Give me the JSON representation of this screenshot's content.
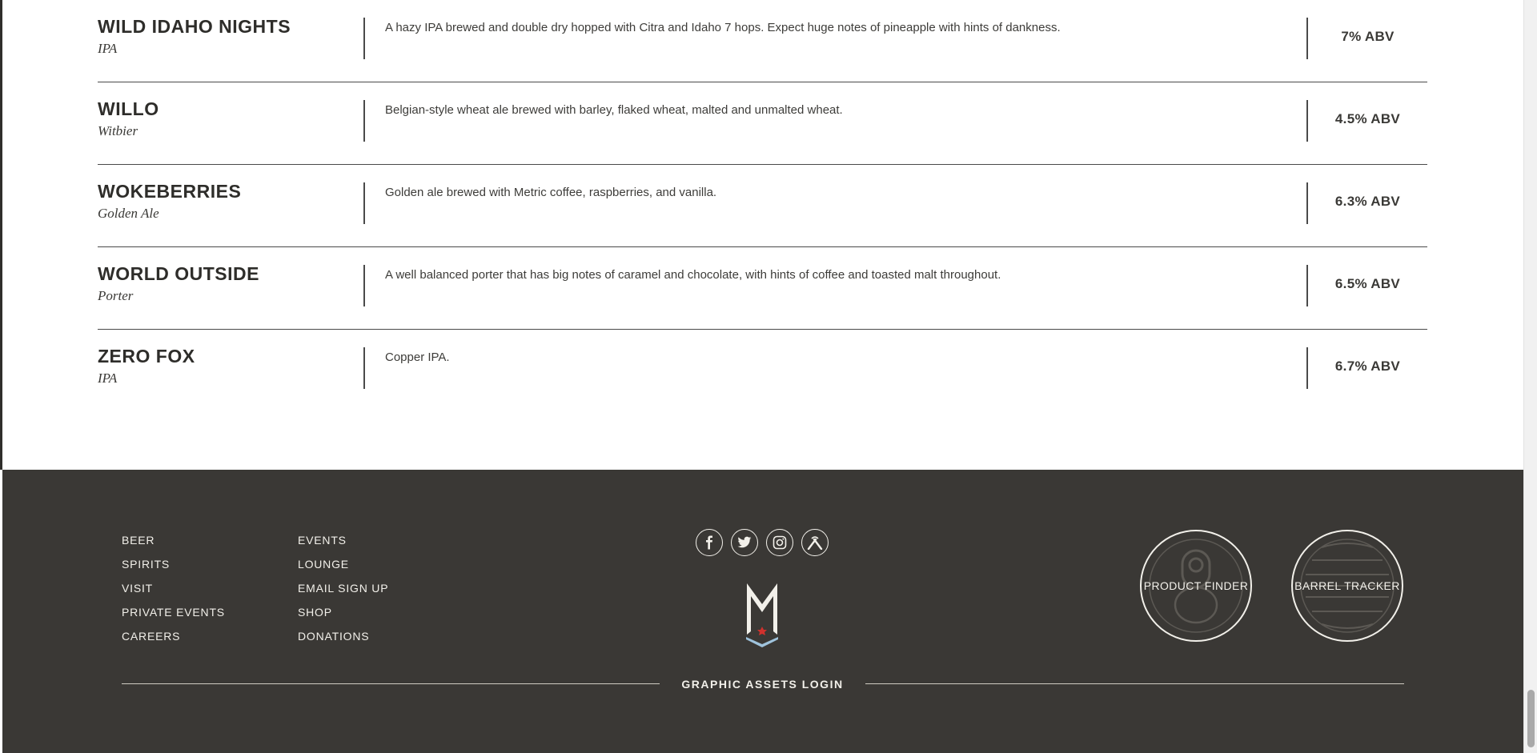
{
  "beers": [
    {
      "name": "WILD IDAHO NIGHTS",
      "style": "IPA",
      "description": "A hazy IPA brewed and double dry hopped with Citra and Idaho 7 hops. Expect huge notes of pineapple with hints of dankness.",
      "abv": "7% ABV"
    },
    {
      "name": "WILLO",
      "style": "Witbier",
      "description": "Belgian-style wheat ale brewed with barley, flaked wheat, malted and unmalted wheat.",
      "abv": "4.5% ABV"
    },
    {
      "name": "WOKEBERRIES",
      "style": "Golden Ale",
      "description": "Golden ale brewed with Metric coffee, raspberries, and vanilla.",
      "abv": "6.3% ABV"
    },
    {
      "name": "WORLD OUTSIDE",
      "style": "Porter",
      "description": "A well balanced porter that has big notes of caramel and chocolate, with hints of coffee and toasted malt throughout.",
      "abv": "6.5% ABV"
    },
    {
      "name": "ZERO FOX",
      "style": "IPA",
      "description": "Copper IPA.",
      "abv": "6.7% ABV"
    }
  ],
  "footer": {
    "nav_col1": [
      "BEER",
      "SPIRITS",
      "VISIT",
      "PRIVATE EVENTS",
      "CAREERS"
    ],
    "nav_col2": [
      "EVENTS",
      "LOUNGE",
      "EMAIL SIGN UP",
      "SHOP",
      "DONATIONS"
    ],
    "social_icons": [
      "facebook-icon",
      "twitter-icon",
      "instagram-icon",
      "untappd-icon"
    ],
    "product_finder": "PRODUCT FINDER",
    "barrel_tracker": "BARREL TRACKER",
    "assets_login": "GRAPHIC ASSETS LOGIN"
  },
  "colors": {
    "footer_bg": "#3a3835",
    "text_dark": "#2e2d2a",
    "footer_text": "#f2f0ea",
    "logo_accent": "#9fc3dc",
    "logo_star": "#d0312d"
  }
}
